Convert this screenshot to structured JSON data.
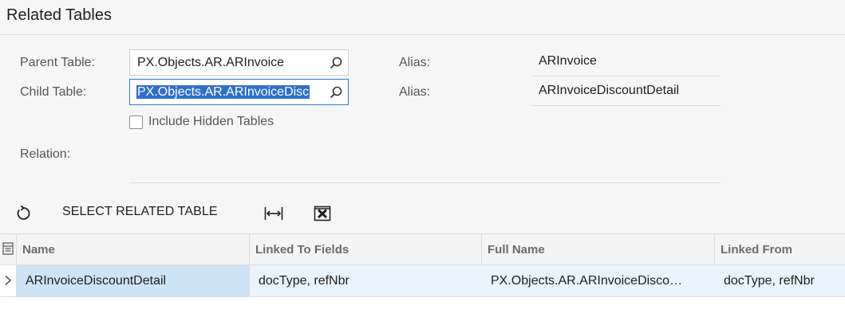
{
  "page": {
    "title": "Related Tables"
  },
  "form": {
    "parent_table_label": "Parent Table:",
    "parent_table_value": "PX.Objects.AR.ARInvoice",
    "child_table_label": "Child Table:",
    "child_table_value": "PX.Objects.AR.ARInvoiceDisc",
    "parent_alias_label": "Alias:",
    "parent_alias_value": "ARInvoice",
    "child_alias_label": "Alias:",
    "child_alias_value": "ARInvoiceDiscountDetail",
    "include_hidden_label": "Include Hidden Tables",
    "include_hidden_checked": false,
    "relation_label": "Relation:",
    "relation_value": ""
  },
  "toolbar": {
    "refresh_icon": "refresh-icon",
    "select_related_label": "SELECT RELATED TABLE",
    "fit_columns_icon": "fit-columns-icon",
    "export_icon": "excel-export-icon"
  },
  "grid": {
    "columns": [
      "Name",
      "Linked To Fields",
      "Full Name",
      "Linked From"
    ],
    "rows": [
      {
        "name": "ARInvoiceDiscountDetail",
        "linked_to_fields": "docType, refNbr",
        "full_name": "PX.Objects.AR.ARInvoiceDisco…",
        "linked_from": "docType, refNbr"
      }
    ]
  },
  "colors": {
    "header_bg": "#f6f6f6",
    "row_selected": "#e9f3fb",
    "cell_active": "#cde4f7",
    "text_highlight": "#2f6fce"
  }
}
